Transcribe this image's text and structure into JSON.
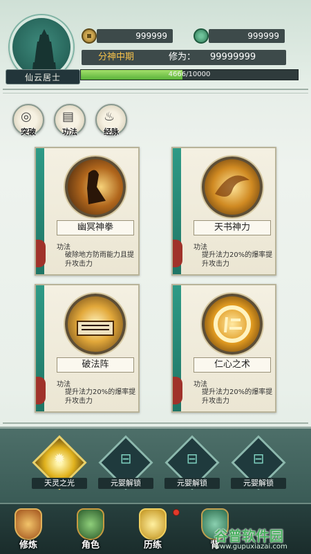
{
  "header": {
    "player_name": "仙云居士",
    "coins": "999999",
    "jade": "999999",
    "realm": "分神中期",
    "cultivation_label": "修为：",
    "cultivation_value": "99999999",
    "progress_text": "4666/10000",
    "progress_fraction": 0.4666
  },
  "tabs": [
    {
      "label": "突破",
      "icon": "breakthrough-icon"
    },
    {
      "label": "功法",
      "icon": "technique-icon"
    },
    {
      "label": "经脉",
      "icon": "meridian-icon"
    }
  ],
  "skills": [
    {
      "name": "幽冥神拳",
      "type": "功法",
      "desc": "破除地方防雨能力且提升攻击力",
      "icon": "fist-warrior-icon"
    },
    {
      "name": "天书神力",
      "type": "功法",
      "desc": "提升法力20%的爆率提升攻击力",
      "icon": "golden-swirl-icon"
    },
    {
      "name": "破法阵",
      "type": "功法",
      "desc": "提升法力20%的爆率提升攻击力",
      "icon": "scroll-formation-icon"
    },
    {
      "name": "仁心之术",
      "type": "功法",
      "desc": "提升法力20%的爆率提升攻击力",
      "icon": "ren-rune-icon"
    }
  ],
  "abilities": [
    {
      "label": "天灵之光",
      "active": true
    },
    {
      "label": "元婴解锁",
      "active": false
    },
    {
      "label": "元婴解锁",
      "active": false
    },
    {
      "label": "元婴解锁",
      "active": false
    }
  ],
  "nav": [
    {
      "label": "修炼",
      "color": "#c98a3a"
    },
    {
      "label": "角色",
      "color": "#3a7a4a"
    },
    {
      "label": "历练",
      "color": "#d9b23a"
    },
    {
      "label": "背",
      "color": "#3a8a6a"
    }
  ],
  "watermark": {
    "main": "谷普软件园",
    "url": "www.gupuxiazai.com"
  },
  "colors": {
    "accent_teal": "#2e9a86",
    "progress_green": "#5ab23a",
    "dark_panel": "#3d4a4a"
  }
}
